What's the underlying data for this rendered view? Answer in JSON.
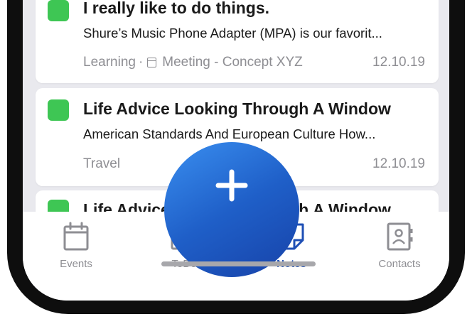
{
  "notes": [
    {
      "title": "I really like to do things.",
      "description": "Shure’s Music Phone Adapter (MPA) is our favorit...",
      "category": "Learning",
      "separator": "·",
      "meeting": "Meeting - Concept XYZ",
      "date": "12.10.19",
      "tag_color": "#3ec654"
    },
    {
      "title": "Life Advice Looking Through A Window",
      "description": "American Standards And European Culture How...",
      "category": "Travel",
      "date": "12.10.19",
      "tag_color": "#3ec654"
    },
    {
      "title": "Life Advice Looking Through A Window",
      "tag_color": "#3ec654"
    }
  ],
  "fab": {
    "icon": "plus-icon",
    "color": "#1f5fc8"
  },
  "tabs": [
    {
      "label": "Events",
      "icon": "calendar-icon",
      "active": false
    },
    {
      "label": "ToDo",
      "icon": "checkbox-icon",
      "active": false
    },
    {
      "label": "Notes",
      "icon": "note-icon",
      "active": true
    },
    {
      "label": "Contacts",
      "icon": "contacts-icon",
      "active": false
    }
  ],
  "colors": {
    "accent": "#1e4fb5",
    "muted": "#8e8e93",
    "tag": "#3ec654"
  }
}
